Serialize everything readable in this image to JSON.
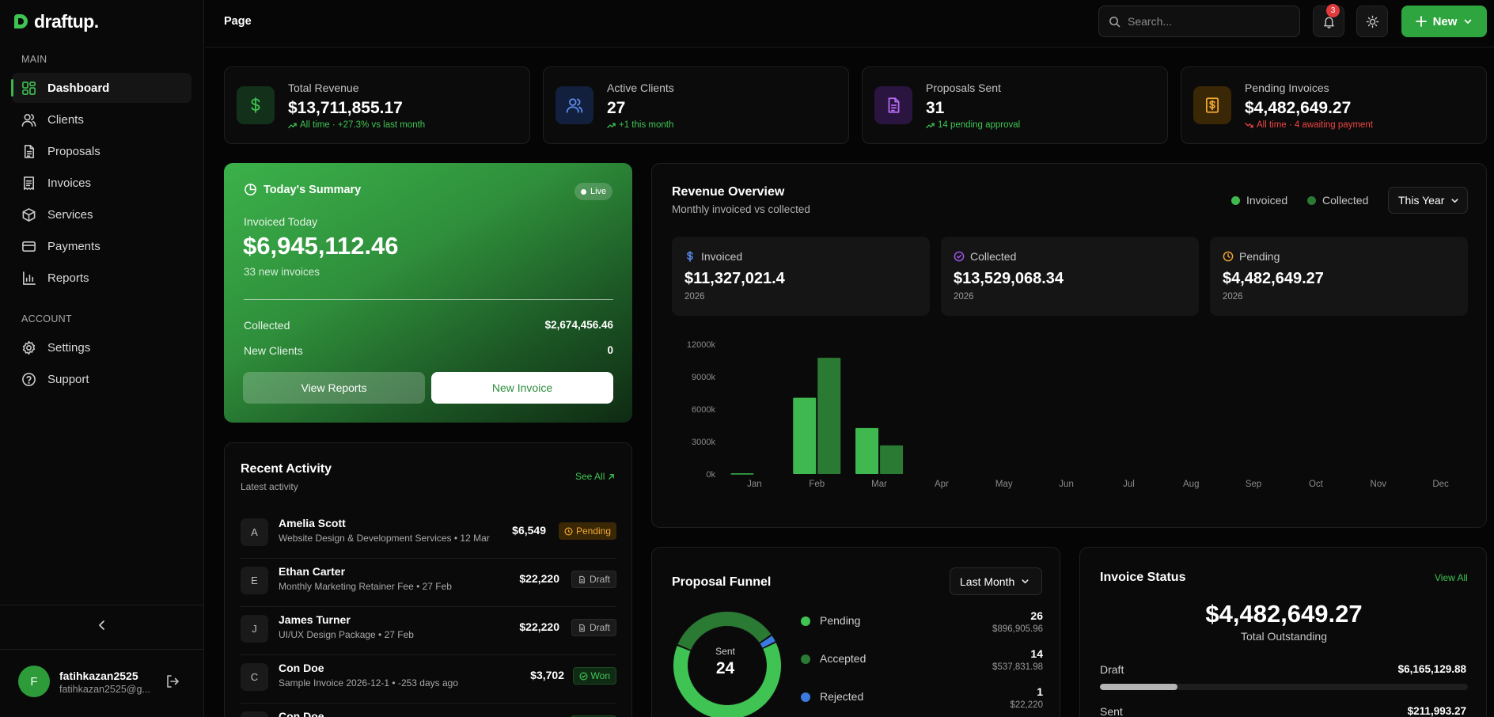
{
  "brand": {
    "name": "draftup."
  },
  "sidebar": {
    "main_label": "MAIN",
    "account_label": "ACCOUNT",
    "items": [
      {
        "label": "Dashboard",
        "icon": "dashboard-icon"
      },
      {
        "label": "Clients",
        "icon": "users-icon"
      },
      {
        "label": "Proposals",
        "icon": "document-icon"
      },
      {
        "label": "Invoices",
        "icon": "receipt-icon"
      },
      {
        "label": "Services",
        "icon": "box-icon"
      },
      {
        "label": "Payments",
        "icon": "credit-card-icon"
      },
      {
        "label": "Reports",
        "icon": "bar-chart-icon"
      }
    ],
    "account_items": [
      {
        "label": "Settings",
        "icon": "gear-icon"
      },
      {
        "label": "Support",
        "icon": "help-icon"
      }
    ],
    "user": {
      "initial": "F",
      "name": "fatihkazan2525",
      "email": "fatihkazan2525@g..."
    }
  },
  "topbar": {
    "page_label": "Page",
    "search_placeholder": "Search...",
    "notification_count": "3",
    "new_button": "New"
  },
  "stats": [
    {
      "label": "Total Revenue",
      "value": "$13,711,855.17",
      "sub": "All time · +27.3% vs last month",
      "trend": "up",
      "color": "#3fc453"
    },
    {
      "label": "Active Clients",
      "value": "27",
      "sub": "+1 this month",
      "trend": "up",
      "color": "#5b8def"
    },
    {
      "label": "Proposals Sent",
      "value": "31",
      "sub": "14 pending approval",
      "trend": "up",
      "color": "#a855f7"
    },
    {
      "label": "Pending Invoices",
      "value": "$4,482,649.27",
      "sub": "All time · 4 awaiting payment",
      "trend": "down",
      "color": "#f2a933"
    }
  ],
  "summary": {
    "title": "Today's Summary",
    "live": "Live",
    "invoiced_label": "Invoiced Today",
    "invoiced_value": "$6,945,112.46",
    "invoiced_sub": "33 new invoices",
    "collected_label": "Collected",
    "collected_value": "$2,674,456.46",
    "new_clients_label": "New Clients",
    "new_clients_value": "0",
    "view_reports": "View Reports",
    "new_invoice": "New Invoice"
  },
  "activity": {
    "title": "Recent Activity",
    "subtitle": "Latest activity",
    "see_all": "See All",
    "rows": [
      {
        "initial": "A",
        "name": "Amelia Scott",
        "desc": "Website Design & Development Services • 12 Mar",
        "amount": "$6,549",
        "status": "Pending"
      },
      {
        "initial": "E",
        "name": "Ethan Carter",
        "desc": "Monthly Marketing Retainer Fee • 27 Feb",
        "amount": "$22,220",
        "status": "Draft"
      },
      {
        "initial": "J",
        "name": "James Turner",
        "desc": "UI/UX Design Package • 27 Feb",
        "amount": "$22,220",
        "status": "Draft"
      },
      {
        "initial": "C",
        "name": "Con Doe",
        "desc": "Sample Invoice 2026-12-1 • -253 days ago",
        "amount": "$3,702",
        "status": "Won"
      },
      {
        "initial": "C",
        "name": "Con Doe",
        "desc": "",
        "amount": "",
        "status": ""
      }
    ]
  },
  "revenue": {
    "title": "Revenue Overview",
    "subtitle": "Monthly invoiced vs collected",
    "legend_invoiced": "Invoiced",
    "legend_collected": "Collected",
    "period": "This Year",
    "cards": [
      {
        "label": "Invoiced",
        "value": "$11,327,021.4",
        "year": "2026",
        "icon": "dollar-icon",
        "color": "#5b8def"
      },
      {
        "label": "Collected",
        "value": "$13,529,068.34",
        "year": "2026",
        "icon": "check-circle-icon",
        "color": "#a855f7"
      },
      {
        "label": "Pending",
        "value": "$4,482,649.27",
        "year": "2026",
        "icon": "clock-icon",
        "color": "#f2a933"
      }
    ]
  },
  "chart_data": {
    "type": "bar",
    "categories": [
      "Jan",
      "Feb",
      "Mar",
      "Apr",
      "May",
      "Jun",
      "Jul",
      "Aug",
      "Sep",
      "Oct",
      "Nov",
      "Dec"
    ],
    "series": [
      {
        "name": "Invoiced",
        "color": "#3fb94f",
        "values": [
          60,
          7050,
          4250,
          0,
          0,
          0,
          0,
          0,
          0,
          0,
          0,
          0
        ]
      },
      {
        "name": "Collected",
        "color": "#2b7a34",
        "values": [
          0,
          10750,
          2650,
          0,
          0,
          0,
          0,
          0,
          0,
          0,
          0,
          0
        ]
      }
    ],
    "yticks": [
      "0k",
      "3000k",
      "6000k",
      "9000k",
      "12000k"
    ],
    "ylim": [
      0,
      12000
    ],
    "yunit": "k",
    "grid": false
  },
  "funnel": {
    "title": "Proposal Funnel",
    "period": "Last Month",
    "center_label": "Sent",
    "center_value": "24",
    "rows": [
      {
        "name": "Pending",
        "count": "26",
        "amount": "$896,905.96",
        "color": "#3fc453"
      },
      {
        "name": "Accepted",
        "count": "14",
        "amount": "$537,831.98",
        "color": "#2b7a34"
      },
      {
        "name": "Rejected",
        "count": "1",
        "amount": "$22,220",
        "color": "#3b7be0"
      }
    ]
  },
  "invoice_status": {
    "title": "Invoice Status",
    "view_all": "View All",
    "total": "$4,482,649.27",
    "total_label": "Total Outstanding",
    "rows": [
      {
        "label": "Draft",
        "value": "$6,165,129.88",
        "fill": 0.21
      },
      {
        "label": "Sent",
        "value": "$211,993.27"
      }
    ]
  }
}
